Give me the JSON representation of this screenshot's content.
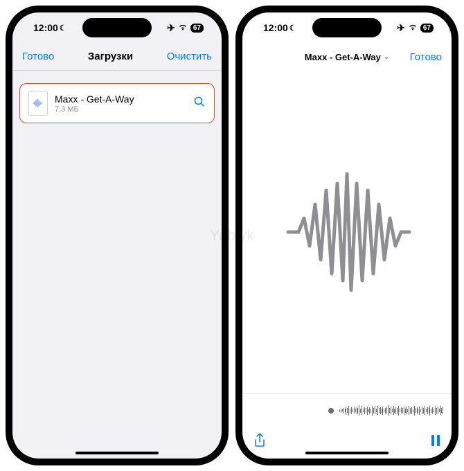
{
  "watermark": "Yablyk",
  "status": {
    "time": "12:00",
    "battery": "67"
  },
  "downloads": {
    "done": "Готово",
    "title": "Загрузки",
    "clear": "Очистить",
    "item": {
      "name": "Maxx - Get-A-Way",
      "size": "7,3 МБ"
    }
  },
  "player": {
    "title": "Maxx - Get-A-Way",
    "done": "Готово"
  }
}
